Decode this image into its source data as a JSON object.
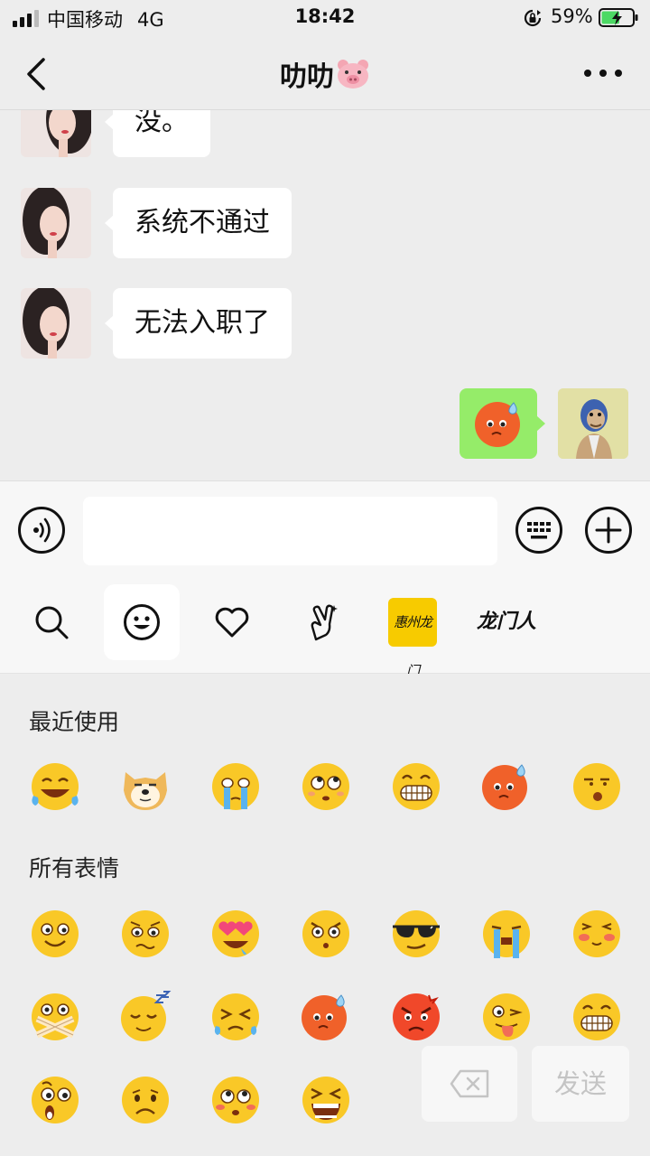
{
  "status_bar": {
    "carrier": "中国移动",
    "network": "4G",
    "time": "18:42",
    "battery_percent": "59%",
    "battery_level": 0.59,
    "signal_bars": 3
  },
  "nav": {
    "back_icon": "chevron-left-icon",
    "title": "叻叻",
    "title_emoji": "pig-face-icon",
    "more_icon": "more-dots-icon"
  },
  "messages": [
    {
      "side": "left",
      "text": "没。"
    },
    {
      "side": "left",
      "text": "系统不通过"
    },
    {
      "side": "left",
      "text": "无法入职了"
    },
    {
      "side": "right",
      "sticker": "sweat-red-face-emoji"
    }
  ],
  "input_bar": {
    "voice_icon": "voice-icon",
    "keyboard_icon": "keyboard-icon",
    "plus_icon": "plus-icon",
    "text_value": ""
  },
  "emoji_tabs": [
    {
      "icon": "search-icon"
    },
    {
      "icon": "smiley-icon",
      "active": true
    },
    {
      "icon": "heart-icon"
    },
    {
      "icon": "victory-hand-icon"
    },
    {
      "label": "惠州龙门"
    },
    {
      "label": "龙门人"
    }
  ],
  "panel": {
    "recent_title": "最近使用",
    "all_title": "所有表情",
    "delete_icon": "backspace-icon",
    "send_label": "发送"
  },
  "colors": {
    "background": "#ededed",
    "my_bubble": "#95ec69",
    "emoji_yellow": "#f9c827",
    "emoji_red": "#f0612a",
    "battery_green": "#4cd964"
  }
}
